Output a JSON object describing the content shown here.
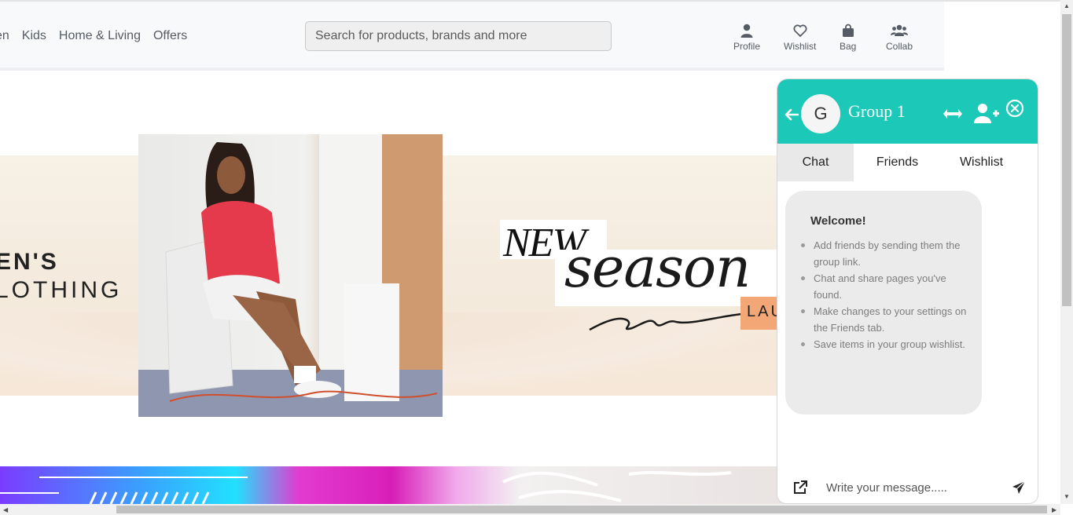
{
  "header": {
    "nav": [
      "en",
      "Kids",
      "Home & Living",
      "Offers"
    ],
    "search_placeholder": "Search for products, brands and more",
    "icons": [
      {
        "label": "Profile",
        "icon": "person-icon"
      },
      {
        "label": "Wishlist",
        "icon": "heart-icon"
      },
      {
        "label": "Bag",
        "icon": "bag-icon"
      },
      {
        "label": "Collab",
        "icon": "users-icon"
      }
    ]
  },
  "banner": {
    "left_line1": "EN'S",
    "left_line2": "LOTHING",
    "new": "NEW",
    "season": "season",
    "launch": "LAU"
  },
  "chat": {
    "avatar_letter": "G",
    "group_name": "Group 1",
    "tabs": [
      "Chat",
      "Friends",
      "Wishlist"
    ],
    "active_tab": "Chat",
    "welcome_title": "Welcome!",
    "welcome_items": [
      "Add friends by sending them the group link.",
      "Chat and share pages you've found.",
      "Make changes to your settings on the Friends tab.",
      "Save items in your group wishlist."
    ],
    "message_placeholder": "Write your message.....",
    "accent_color": "#1cc8b7"
  }
}
